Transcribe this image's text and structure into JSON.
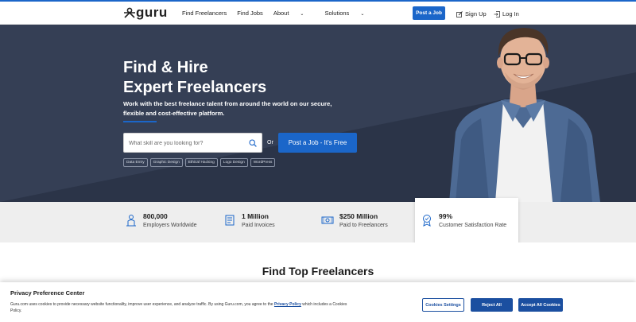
{
  "header": {
    "logo": "guru",
    "nav": [
      {
        "label": "Find Freelancers",
        "has_dropdown": false
      },
      {
        "label": "Find Jobs",
        "has_dropdown": false
      },
      {
        "label": "About",
        "has_dropdown": true
      },
      {
        "label": "Solutions",
        "has_dropdown": true
      }
    ],
    "post_job_label": "Post a Job",
    "signup_label": "Sign Up",
    "login_label": "Log In"
  },
  "hero": {
    "title_line1": "Find & Hire",
    "title_line2": "Expert Freelancers",
    "subtitle": "Work with the best freelance talent from around the world on our secure, flexible and cost-effective platform.",
    "search_placeholder": "What skill are you looking for?",
    "or_text": "Or",
    "post_job_cta": "Post a Job - It's Free",
    "tags": [
      "Data Entry",
      "Graphic Design",
      "Ethical Hacking",
      "Logo Design",
      "WordPress"
    ]
  },
  "stats": [
    {
      "value": "800,000",
      "label": "Employers Worldwide",
      "icon": "employers-icon"
    },
    {
      "value": "1 Million",
      "label": "Paid Invoices",
      "icon": "invoice-icon"
    },
    {
      "value": "$250 Million",
      "label": "Paid to Freelancers",
      "icon": "money-icon"
    },
    {
      "value": "99%",
      "label": "Customer Satisfaction Rate",
      "icon": "award-icon"
    }
  ],
  "section_title": "Find Top Freelancers",
  "cookie": {
    "title": "Privacy Preference Center",
    "text_before": "Guru.com uses cookies to provide necessary website functionality, improve user experience, and analyze traffic. By using Guru.com, you agree to the ",
    "link": "Privacy Policy",
    "text_after": " which includes a Cookies Policy.",
    "settings_label": "Cookies Settings",
    "reject_label": "Reject All",
    "accept_label": "Accept All Cookies"
  },
  "colors": {
    "brand_blue": "#1b66c9",
    "hero_bg": "#2b3448",
    "cookie_blue": "#1b4fa0"
  }
}
